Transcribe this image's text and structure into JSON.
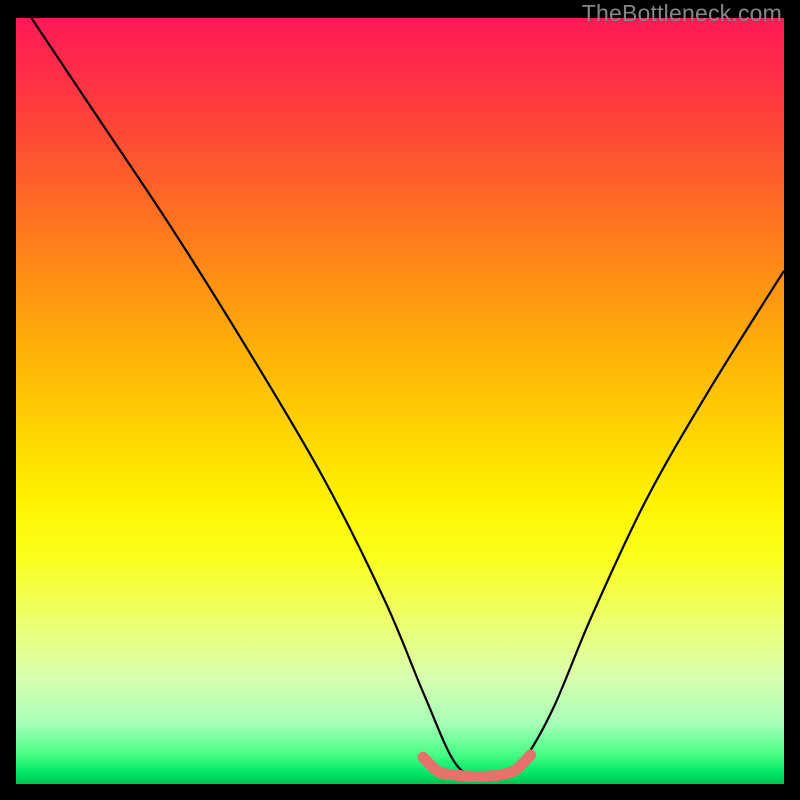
{
  "watermark": "TheBottleneck.com",
  "chart_data": {
    "type": "line",
    "title": "",
    "xlabel": "",
    "ylabel": "",
    "xlim": [
      0,
      100
    ],
    "ylim": [
      0,
      100
    ],
    "grid": false,
    "series": [
      {
        "name": "bottleneck-curve",
        "color": "#000000",
        "x": [
          2,
          10,
          20,
          30,
          40,
          48,
          53,
          57,
          60,
          63,
          66,
          70,
          75,
          82,
          90,
          100
        ],
        "y": [
          100,
          88,
          73,
          57,
          40,
          24,
          12,
          3,
          1,
          1,
          3,
          10,
          22,
          37,
          51,
          67
        ]
      },
      {
        "name": "optimal-band",
        "color": "#e6726b",
        "x": [
          53,
          55,
          57,
          59,
          61,
          63,
          65,
          67
        ],
        "y": [
          3.5,
          1.6,
          1.2,
          1.0,
          1.0,
          1.2,
          1.8,
          3.8
        ]
      }
    ]
  }
}
